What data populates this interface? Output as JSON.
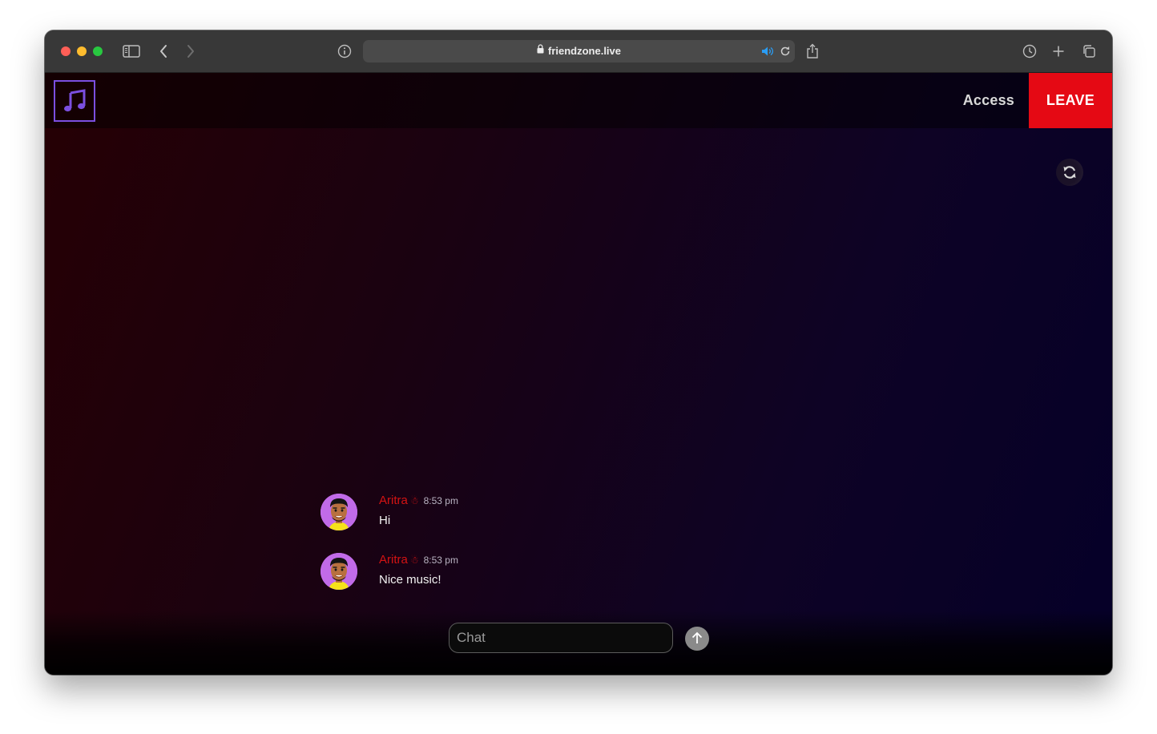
{
  "browser": {
    "url": "friendzone.live",
    "icons": [
      "sidebar-icon",
      "back-icon",
      "forward-icon",
      "info-icon",
      "lock-icon",
      "audio-icon",
      "reload-icon",
      "share-icon",
      "history-icon",
      "new-tab-icon",
      "tab-overview-icon"
    ]
  },
  "header": {
    "logo_icon": "music-note-icon",
    "access_label": "Access",
    "leave_label": "LEAVE"
  },
  "messages": [
    {
      "name": "Aritra",
      "emoji": "☃",
      "time": "8:53 pm",
      "text": "Hi"
    },
    {
      "name": "Aritra",
      "emoji": "☃",
      "time": "8:53 pm",
      "text": "Nice music!"
    }
  ],
  "chat": {
    "placeholder": "Chat",
    "value": ""
  },
  "colors": {
    "accent": "#e50914",
    "name": "#d41313",
    "logo": "#7b4fe0"
  }
}
